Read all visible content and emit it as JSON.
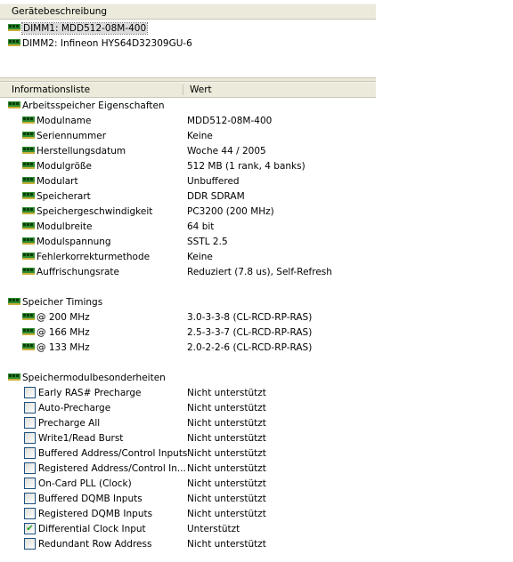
{
  "top_pane": {
    "header": "Gerätebeschreibung",
    "devices": [
      {
        "label": "DIMM1: MDD512-08M-400",
        "selected": true
      },
      {
        "label": "DIMM2: Infineon HYS64D32309GU-6",
        "selected": false
      }
    ]
  },
  "bottom_pane": {
    "col_info": "Informationsliste",
    "col_value": "Wert",
    "groups": [
      {
        "title": "Arbeitsspeicher Eigenschaften",
        "rows": [
          {
            "name": "Modulname",
            "value": "MDD512-08M-400"
          },
          {
            "name": "Seriennummer",
            "value": "Keine"
          },
          {
            "name": "Herstellungsdatum",
            "value": "Woche 44 / 2005"
          },
          {
            "name": "Modulgröße",
            "value": "512 MB (1 rank, 4 banks)"
          },
          {
            "name": "Modulart",
            "value": "Unbuffered"
          },
          {
            "name": "Speicherart",
            "value": "DDR SDRAM"
          },
          {
            "name": "Speichergeschwindigkeit",
            "value": "PC3200 (200 MHz)"
          },
          {
            "name": "Modulbreite",
            "value": "64 bit"
          },
          {
            "name": "Modulspannung",
            "value": "SSTL 2.5"
          },
          {
            "name": "Fehlerkorrekturmethode",
            "value": "Keine"
          },
          {
            "name": "Auffrischungsrate",
            "value": "Reduziert (7.8 us), Self-Refresh"
          }
        ]
      },
      {
        "title": "Speicher Timings",
        "rows": [
          {
            "name": "@ 200 MHz",
            "value": "3.0-3-3-8  (CL-RCD-RP-RAS)"
          },
          {
            "name": "@ 166 MHz",
            "value": "2.5-3-3-7  (CL-RCD-RP-RAS)"
          },
          {
            "name": "@ 133 MHz",
            "value": "2.0-2-2-6  (CL-RCD-RP-RAS)"
          }
        ]
      },
      {
        "title": "Speichermodulbesonderheiten",
        "rows": [
          {
            "name": "Early RAS# Precharge",
            "value": "Nicht unterstützt",
            "checked": false
          },
          {
            "name": "Auto-Precharge",
            "value": "Nicht unterstützt",
            "checked": false
          },
          {
            "name": "Precharge All",
            "value": "Nicht unterstützt",
            "checked": false
          },
          {
            "name": "Write1/Read Burst",
            "value": "Nicht unterstützt",
            "checked": false
          },
          {
            "name": "Buffered Address/Control Inputs",
            "value": "Nicht unterstützt",
            "checked": false
          },
          {
            "name": "Registered Address/Control In...",
            "value": "Nicht unterstützt",
            "checked": false
          },
          {
            "name": "On-Card PLL (Clock)",
            "value": "Nicht unterstützt",
            "checked": false
          },
          {
            "name": "Buffered DQMB Inputs",
            "value": "Nicht unterstützt",
            "checked": false
          },
          {
            "name": "Registered DQMB Inputs",
            "value": "Nicht unterstützt",
            "checked": false
          },
          {
            "name": "Differential Clock Input",
            "value": "Unterstützt",
            "checked": true
          },
          {
            "name": "Redundant Row Address",
            "value": "Nicht unterstützt",
            "checked": false
          }
        ]
      }
    ]
  }
}
